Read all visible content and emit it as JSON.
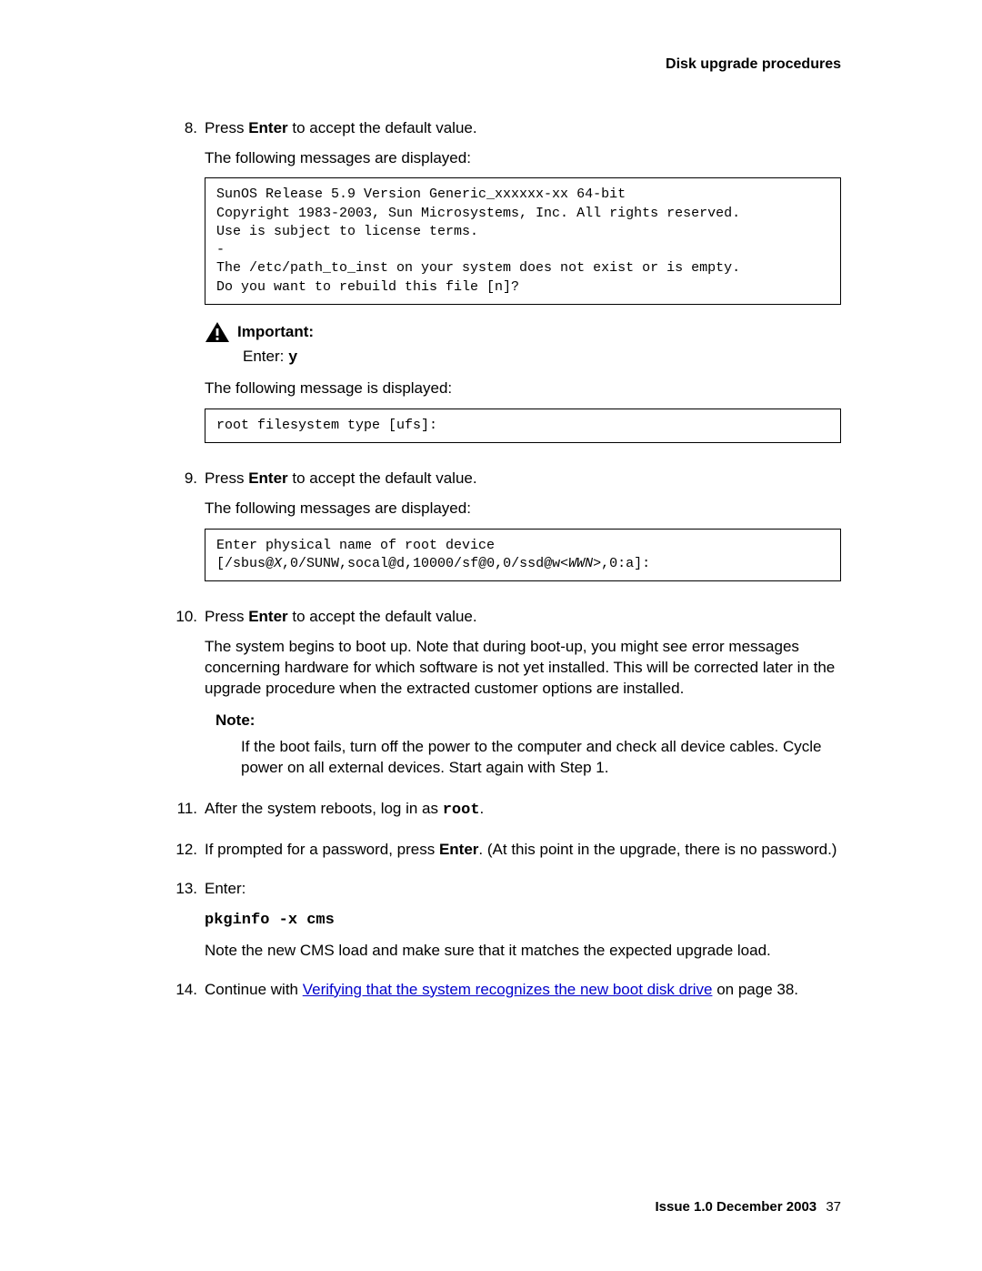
{
  "header": {
    "title": "Disk upgrade procedures"
  },
  "steps": {
    "s8": {
      "num": "8.",
      "line1_a": "Press ",
      "line1_b": "Enter",
      "line1_c": " to accept the default value.",
      "follow1": "The following messages are displayed:",
      "code1": "SunOS Release 5.9 Version Generic_xxxxxx-xx 64-bit\nCopyright 1983-2003, Sun Microsystems, Inc. All rights reserved.\nUse is subject to license terms.\n-\nThe /etc/path_to_inst on your system does not exist or is empty.\nDo you want to rebuild this file [n]?",
      "important_label": "Important:",
      "important_enter": "Enter: ",
      "important_y": "y",
      "follow2": "The following message is displayed:",
      "code2": "root filesystem type [ufs]:"
    },
    "s9": {
      "num": "9.",
      "line1_a": "Press ",
      "line1_b": "Enter",
      "line1_c": " to accept the default value.",
      "follow1": "The following messages are displayed:",
      "code_pre": "Enter physical name of root device\n[/sbus@",
      "code_x": "X",
      "code_mid": ",0/SUNW,socal@d,10000/sf@0,0/ssd@w<",
      "code_wwn": "WWN",
      "code_post": ">,0:a]:"
    },
    "s10": {
      "num": "10.",
      "line1_a": "Press ",
      "line1_b": "Enter",
      "line1_c": " to accept the default value.",
      "para": "The system begins to boot up. Note that during boot-up, you might see error messages concerning hardware for which software is not yet installed. This will be corrected later in the upgrade procedure when the extracted customer options are installed.",
      "note_title": "Note:",
      "note_body": "If the boot fails, turn off the power to the computer and check all device cables. Cycle power on all external devices. Start again with Step 1."
    },
    "s11": {
      "num": "11.",
      "a": "After the system reboots, log in as ",
      "b": "root",
      "c": "."
    },
    "s12": {
      "num": "12.",
      "a": "If prompted for a password, press ",
      "b": "Enter",
      "c": ". (At this point in the upgrade, there is no password.)"
    },
    "s13": {
      "num": "13.",
      "a": "Enter:",
      "cmd": "pkginfo -x cms",
      "after": "Note the new CMS load and make sure that it matches the expected upgrade load."
    },
    "s14": {
      "num": "14.",
      "a": "Continue with ",
      "link": "Verifying that the system recognizes the new boot disk drive",
      "c": " on page 38."
    }
  },
  "footer": {
    "issue": "Issue 1.0   December 2003",
    "page": "37"
  }
}
